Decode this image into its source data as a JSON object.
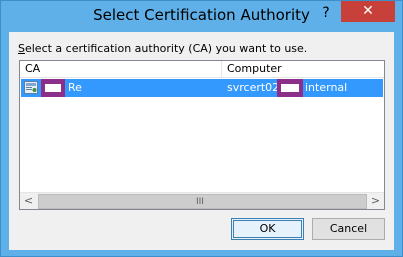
{
  "window": {
    "title": "Select Certification Authority",
    "help_glyph": "?",
    "close_glyph": "✕"
  },
  "instruction": {
    "accel": "S",
    "rest": "elect a certification authority (CA) you want to use."
  },
  "list": {
    "columns": [
      "CA",
      "Computer"
    ],
    "rows": [
      {
        "ca_suffix": "Re",
        "computer_prefix": "svrcert02.",
        "computer_suffix": "internal",
        "selected": true
      }
    ]
  },
  "scrollbar": {
    "left_arrow": "<",
    "right_arrow": ">",
    "grip": "III"
  },
  "buttons": {
    "ok": "OK",
    "cancel": "Cancel"
  },
  "colors": {
    "titlebar": "#5fb0e8",
    "close": "#c7413a",
    "selection": "#3399ff",
    "redaction": "#8b2f8b"
  }
}
